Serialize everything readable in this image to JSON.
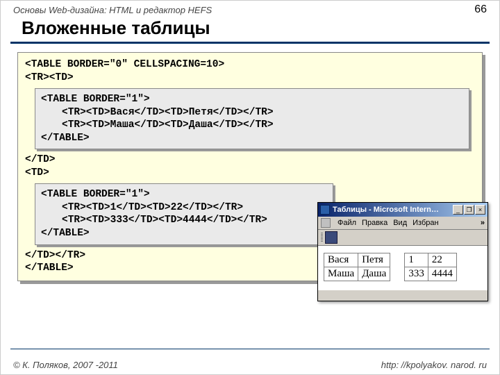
{
  "header": {
    "course": "Основы Web-дизайна: HTML и редактор HEFS",
    "page": "66"
  },
  "title": "Вложенные таблицы",
  "code": {
    "outer_open1": "<TABLE BORDER=\"0\" CELLSPACING=10>",
    "outer_open2": "<TR><TD>",
    "inner1_l1": "<TABLE BORDER=\"1\">",
    "inner1_l2": "<TR><TD>Вася</TD><TD>Петя</TD></TR>",
    "inner1_l3": "<TR><TD>Маша</TD><TD>Даша</TD></TR>",
    "inner1_l4": "</TABLE>",
    "mid1": "</TD>",
    "mid2": "<TD>",
    "inner2_l1": "<TABLE BORDER=\"1\">",
    "inner2_l2": "<TR><TD>1</TD><TD>22</TD></TR>",
    "inner2_l3": "<TR><TD>333</TD><TD>4444</TD></TR>",
    "inner2_l4": "</TABLE>",
    "outer_close1": "</TD></TR>",
    "outer_close2": "</TABLE>"
  },
  "browser": {
    "title": "Таблицы - Microsoft Intern…",
    "menu": {
      "file": "Файл",
      "edit": "Правка",
      "view": "Вид",
      "fav": "Избран",
      "more": "»"
    },
    "win": {
      "min": "_",
      "max": "❐",
      "close": "×"
    },
    "table1": {
      "r1c1": "Вася",
      "r1c2": "Петя",
      "r2c1": "Маша",
      "r2c2": "Даша"
    },
    "table2": {
      "r1c1": "1",
      "r1c2": "22",
      "r2c1": "333",
      "r2c2": "4444"
    }
  },
  "footer": {
    "copyright": "© К. Поляков, 2007 -2011",
    "url": "http: //kpolyakov. narod. ru"
  }
}
